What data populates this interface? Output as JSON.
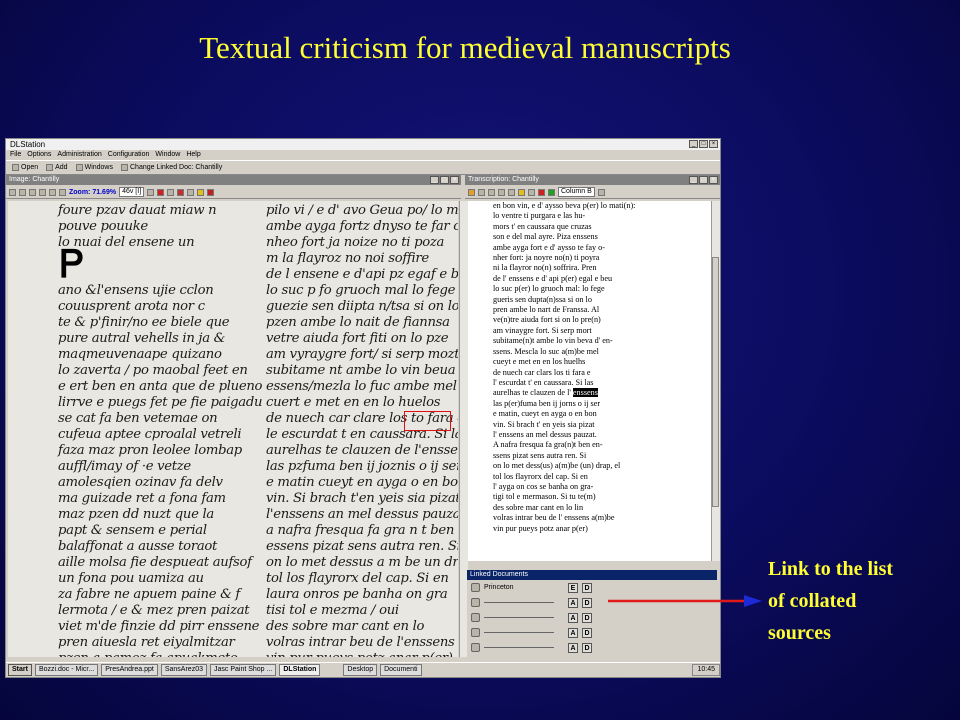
{
  "slide": {
    "title": "Textual criticism for medieval manuscripts",
    "note_lines": [
      "Link to the list",
      "of collated",
      "sources"
    ],
    "accent_color": "#ffff33"
  },
  "app": {
    "title": "DLStation",
    "menu": [
      "File",
      "Options",
      "Administration",
      "Configuration",
      "Window",
      "Help"
    ],
    "toolbar": [
      "Open",
      "Add",
      "Windows",
      "Change Linked Doc: Chantilly"
    ]
  },
  "image_panel": {
    "title": "Image: Chantilly",
    "zoom": "Zoom: 71.69%",
    "page_select": "46v [I]",
    "manuscript_col1": [
      "foure pzav dauat miaw n",
      "pouve pouuke",
      "lo nuai del ensene un",
      "",
      "",
      "ano &l'ensens ujie cclon",
      "couusprent arota nor c",
      "te & p'finir/no ee biele que",
      "pure autral vehells in ja &",
      "maqmeuvenaape quizano",
      "lo zaverta / po maobal feet en",
      "e ert ben en anta que de plueno",
      "lirrve e puegs fet pe fie paigadu",
      "se cat fa ben vetemae on",
      "cufeua aptee cproalal vetreli",
      "faza maz pron leolee lombap",
      "auffl/imay of ·e vetze",
      "amolesqien ozinav fa delv",
      "ma guizade ret a fona fam",
      "maz pzen dd nuzt que la",
      "papt & sensem e perial",
      "balaffonat a ausse toraot",
      "aille molsa fie despueat aufsof",
      "un fona pou uamiza au",
      "za fabre ne apuem paine & f",
      "lermota / e & mez pren paizat",
      "viet m'de finzie dd pirr enssene",
      "pren aiuesla ret eiyalmitzar",
      "pzen a pamoz fa apuakmeto"
    ],
    "manuscript_col2": [
      "pilo vi / e d' avo Geua po/ lo ma",
      "ambe ayga fortz dnyso te far o",
      "nheo fort ja noize no ti poza",
      "m la flayroz no noi soffire",
      "de l ensene e d'api pz egaf e beu",
      "lo suc p fo gruoch mal lo fege",
      "guezie sen diipta n/tsa si on lo",
      "pzen ambe lo nait de fiannsa",
      "vetre aiuda fort fiti on lo pze",
      "am vyraygre fort/ si serp mozt",
      "subitame nt ambe lo vin beua de",
      "essens/mezla lo fuc ambe mel",
      "cuert e met en en lo huelos",
      "de nuech car clare los to fara e",
      "le escurdat t en caussara. Si las",
      "aurelhas te clauzen de l'enssens",
      "las pzfuma ben ij joznis o ij ser",
      "e matin cueyt en ayga o en bon",
      "vin. Si brach t'en yeis sia pizat",
      "l'enssens an mel dessus pauzat",
      "a nafra fresqua fa gra n t ben",
      "essens pizat sens autra ren. Si",
      "on lo met dessus a m be un drap",
      "tol los flayrorx del cap. Si en",
      "laura onros pe banha on gra",
      "tisi tol e mezma / oui",
      "des sobre mar cant en lo",
      "volras intrar beu de l'enssens",
      "vin pur pueys potz anar p(er)"
    ]
  },
  "transcription_panel": {
    "title": "Transcription: Chantilly",
    "column_select": "Column B",
    "lines": [
      "en bon vin, e d' aysso beva p(er) lo mati(n):",
      "lo ventre ti purgara e las hu-",
      "mors t' en caussara que cruzas",
      "son e del mal ayre. Piza enssens",
      "ambe ayga fort e d' aysso te fay o-",
      "nher fort: ja noyre no(n) ti poyra",
      "ni la flayror no(n) soffrira. Pren",
      "de l' enssens e d' api p(er) egal e beu",
      "lo suc p(er) lo gruoch mal: lo fege",
      "gueris sen dupta(n)ssa si on lo",
      "pren ambe lo nart de Franssa. Al",
      "ve(n)tre aiuda fort si on lo pre(n)",
      "am vinaygre fort. Si serp mort",
      "subitame(n)t ambe lo vin beva d' en-",
      "ssens. Mescla lo suc a(m)be mel",
      "cueyt e met en en los huelhs",
      "de nuech car clars los ti fara e",
      "l' escurdat t' en caussara. Si las",
      "aurelhas te clauzen de l' ",
      "las p(er)fuma ben ij jorns o ij ser",
      "e matin, cueyt en ayga o en bon",
      "vin. Si brach t' en yeis sia pizat",
      "l' enssens an mel dessus pauzat.",
      "A nafra fresqua fa gra(n)t ben en-",
      "ssens pizat sens autra ren. Si",
      "on lo met dess(us) a(m)be (un) drap, el",
      "tol los flayrorx del cap. Si en",
      "l' ayga on cos se banha on gra-",
      "tigi tol e mermason. Si tu te(m)",
      "des sobre mar cant en lo lin",
      "volras intrar beu de l' enssens a(m)be",
      "vin pur pueys potz anar p(er)"
    ],
    "highlight_word": "enssens"
  },
  "linked_documents": {
    "title": "Linked Documents",
    "rows": [
      {
        "name": "Princeton",
        "buttons": [
          "E",
          "D"
        ]
      },
      {
        "name": "",
        "buttons": [
          "A",
          "D"
        ]
      },
      {
        "name": "",
        "buttons": [
          "A",
          "D"
        ]
      },
      {
        "name": "",
        "buttons": [
          "A",
          "D"
        ]
      },
      {
        "name": "",
        "buttons": [
          "A",
          "D"
        ]
      }
    ]
  },
  "taskbar": {
    "start": "Start",
    "tasks": [
      "Bozzi.doc - Micr...",
      "PresAndrea.ppt",
      "SansArez03",
      "Jasc Paint Shop ...",
      "DLStation"
    ],
    "desktop": "Desktop",
    "documents": "Documenti",
    "clock": "10:45"
  }
}
